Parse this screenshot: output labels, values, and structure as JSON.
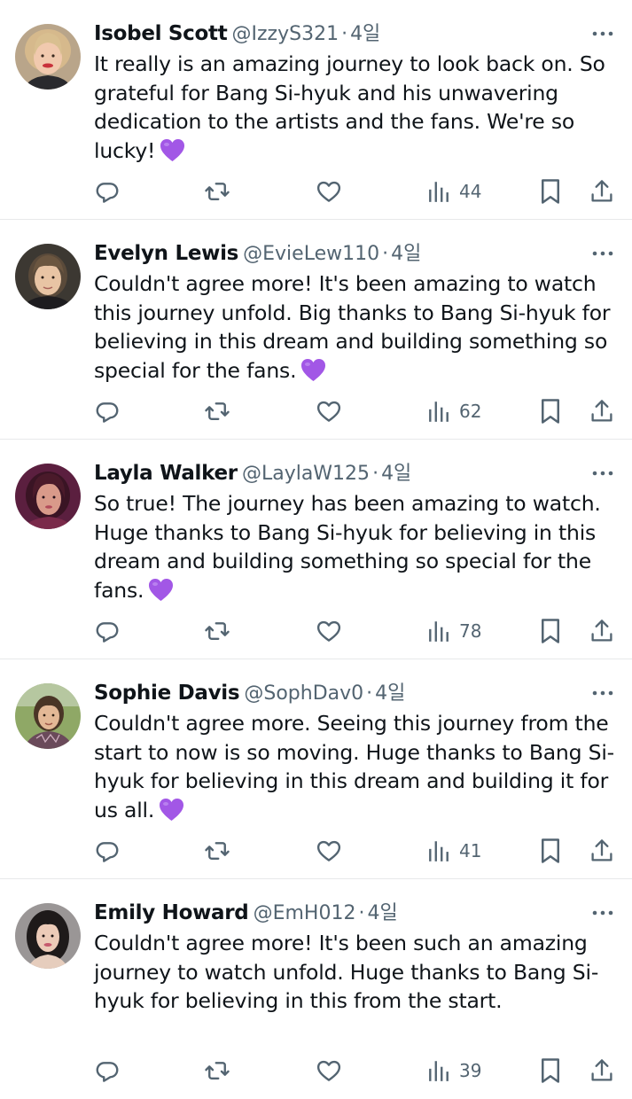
{
  "colors": {
    "text": "#0f1419",
    "secondary": "#536471",
    "divider": "#e7e9ea",
    "emoji_heart": "#a257e6"
  },
  "icons": {
    "reply": "reply-icon",
    "retweet": "retweet-icon",
    "like": "like-icon",
    "views": "views-icon",
    "bookmark": "bookmark-icon",
    "share": "share-icon",
    "more": "more-icon",
    "emoji": "purple-heart-emoji"
  },
  "separator": "·",
  "tweets": [
    {
      "name": "Isobel Scott",
      "handle": "@IzzyS321",
      "time": "4일",
      "text": "It really is an amazing journey to look back on. So grateful for Bang Si-hyuk and his unwavering dedication to the artists and the fans. We're so lucky!",
      "emoji": true,
      "views": "44"
    },
    {
      "name": "Evelyn Lewis",
      "handle": "@EvieLew110",
      "time": "4일",
      "text": "Couldn't agree more! It's been amazing to watch this journey unfold. Big thanks to Bang Si-hyuk for believing in this dream and building something so special for the fans.",
      "emoji": true,
      "views": "62"
    },
    {
      "name": "Layla Walker",
      "handle": "@LaylaW125",
      "time": "4일",
      "text": "So true! The journey has been amazing to watch. Huge thanks to Bang Si-hyuk for believing in this dream and building something so special for the fans.",
      "emoji": true,
      "views": "78"
    },
    {
      "name": "Sophie Davis",
      "handle": "@SophDav0",
      "time": "4일",
      "text": "Couldn't agree more. Seeing this journey from the start to now is so moving. Huge thanks to Bang Si-hyuk for believing in this dream and building it for us all.",
      "emoji": true,
      "views": "41"
    },
    {
      "name": "Emily Howard",
      "handle": "@EmH012",
      "time": "4일",
      "text": "Couldn't agree more! It's been such an amazing journey to watch unfold. Huge thanks to Bang Si-hyuk for believing in this from the start.",
      "emoji": false,
      "views": "39"
    }
  ]
}
